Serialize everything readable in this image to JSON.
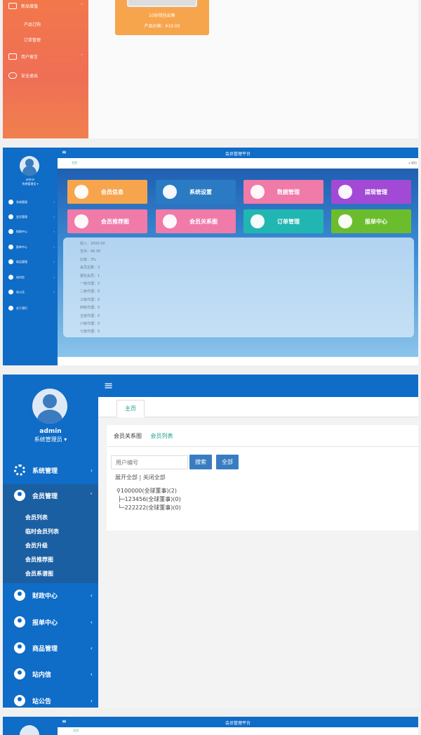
{
  "panel1": {
    "menu": [
      {
        "label": "新品增值",
        "icon": "calendar-icon",
        "has_chevron": true
      },
      {
        "label": "产品订购",
        "sub": true
      },
      {
        "label": "订单管理",
        "sub": true
      },
      {
        "label": "用户留言",
        "icon": "mail-icon",
        "has_chevron": true
      },
      {
        "label": "安全退出",
        "icon": "toggle-icon",
        "has_chevron": false
      }
    ],
    "product": {
      "name": "10份钱包出售",
      "price": "产品价格：¥10.00"
    },
    "colors": {
      "sidebar": "#f2784b",
      "card": "#f7a54d"
    }
  },
  "panel2": {
    "app_title": "会员管理平台",
    "tab": "主页",
    "right_label": "▸ 退出",
    "user": {
      "name": "admin",
      "role": "系统管理员 ▾"
    },
    "menu": [
      "系统管理",
      "会员管理",
      "财政中心",
      "报单中心",
      "商品管理",
      "站内信",
      "站公告",
      "关于我们"
    ],
    "tiles": [
      {
        "label": "会员信息",
        "color": "#f7a54d"
      },
      {
        "label": "系统设置",
        "color": "#2a7bc4"
      },
      {
        "label": "数据管理",
        "color": "#f07aa8"
      },
      {
        "label": "提现管理",
        "color": "#a24ad6"
      },
      {
        "label": "会员推荐图",
        "color": "#f07aa8"
      },
      {
        "label": "会员关系图",
        "color": "#f07aa8"
      },
      {
        "label": "订单管理",
        "color": "#22b6b2"
      },
      {
        "label": "报单中心",
        "color": "#6bbd2e"
      }
    ],
    "stats": [
      "收入：2000.00",
      "支出：66.00",
      "比率：3%",
      "会员总数：3",
      "报社会员：1",
      "一级代理：2",
      "二级代理：0",
      "三级代理：0",
      "四级代理：0",
      "五级代理：0",
      "六级代理：0",
      "七级代理：0"
    ]
  },
  "panel3": {
    "tab": "主页",
    "user": {
      "name": "admin",
      "role": "系统管理员 ▾"
    },
    "menu": {
      "system": "系统管理",
      "member": "会员管理",
      "member_sub": [
        "会员列表",
        "临时会员列表",
        "会员升级",
        "会员推荐图",
        "会员系谱图"
      ],
      "finance": "财政中心",
      "orders": "报单中心",
      "goods": "商品管理",
      "inbox": "站内信",
      "notice": "站公告"
    },
    "card_tabs": {
      "relation": "会员关系图",
      "list": "会员列表"
    },
    "search": {
      "placeholder": "用户编号",
      "button": "搜索",
      "all_button": "全部"
    },
    "expand": "展开全部 | 关闭全部",
    "tree": [
      "100000(全球董事)(2)",
      "├─123456(全球董事)(0)",
      "└─222222(全球董事)(0)"
    ]
  },
  "panel4": {
    "app_title": "会员管理平台",
    "tab": "主页"
  }
}
